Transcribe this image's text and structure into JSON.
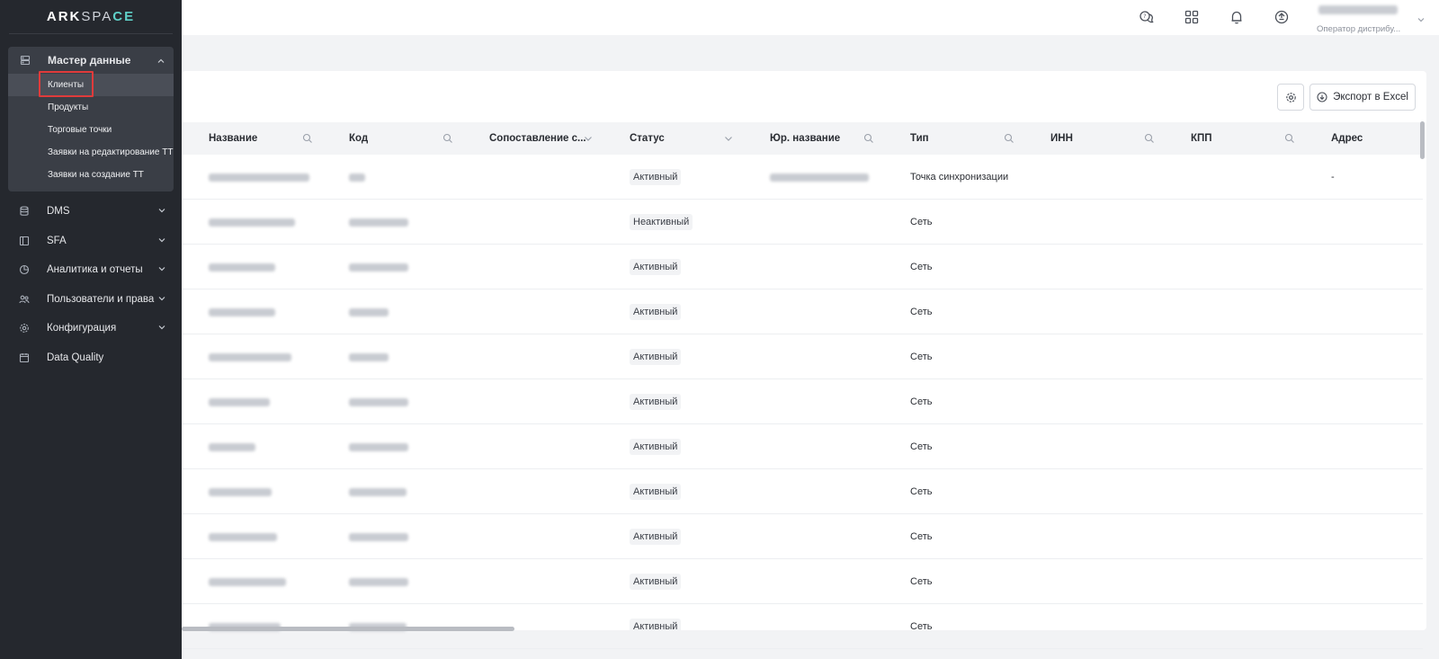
{
  "logo": {
    "part1": "ARK",
    "part2": "SPA",
    "part3": "CE"
  },
  "sidebar": {
    "master": {
      "label": "Мастер данные",
      "items": [
        {
          "label": "Клиенты"
        },
        {
          "label": "Продукты"
        },
        {
          "label": "Торговые точки"
        },
        {
          "label": "Заявки на редактирование ТТ"
        },
        {
          "label": "Заявки на создание ТТ"
        }
      ]
    },
    "items": [
      {
        "label": "DMS"
      },
      {
        "label": "SFA"
      },
      {
        "label": "Аналитика и отчеты"
      },
      {
        "label": "Пользователи и права"
      },
      {
        "label": "Конфигурация"
      },
      {
        "label": "Data Quality"
      }
    ]
  },
  "topbar": {
    "icons": [
      "chat-icon",
      "apps-grid-icon",
      "bell-icon",
      "sync-icon"
    ],
    "user_role": "Оператор дистрибу..."
  },
  "toolbar": {
    "export_label": "Экспорт в Excel"
  },
  "table": {
    "columns": [
      {
        "label": "Название"
      },
      {
        "label": "Код"
      },
      {
        "label": "Сопоставление с..."
      },
      {
        "label": "Статус"
      },
      {
        "label": "Юр. название"
      },
      {
        "label": "Тип"
      },
      {
        "label": "ИНН"
      },
      {
        "label": "КПП"
      },
      {
        "label": "Адрес"
      }
    ],
    "rows": [
      {
        "status": "Активный",
        "type": "Точка синхронизации",
        "address": "-"
      },
      {
        "status": "Неактивный",
        "type": "Сеть",
        "address": ""
      },
      {
        "status": "Активный",
        "type": "Сеть",
        "address": ""
      },
      {
        "status": "Активный",
        "type": "Сеть",
        "address": ""
      },
      {
        "status": "Активный",
        "type": "Сеть",
        "address": ""
      },
      {
        "status": "Активный",
        "type": "Сеть",
        "address": ""
      },
      {
        "status": "Активный",
        "type": "Сеть",
        "address": ""
      },
      {
        "status": "Активный",
        "type": "Сеть",
        "address": ""
      },
      {
        "status": "Активный",
        "type": "Сеть",
        "address": ""
      },
      {
        "status": "Активный",
        "type": "Сеть",
        "address": ""
      },
      {
        "status": "Активный",
        "type": "Сеть",
        "address": ""
      }
    ]
  },
  "colors": {
    "sidebar_bg": "#25282e",
    "accent": "#5fd0c8",
    "highlight": "#e03b3b"
  }
}
